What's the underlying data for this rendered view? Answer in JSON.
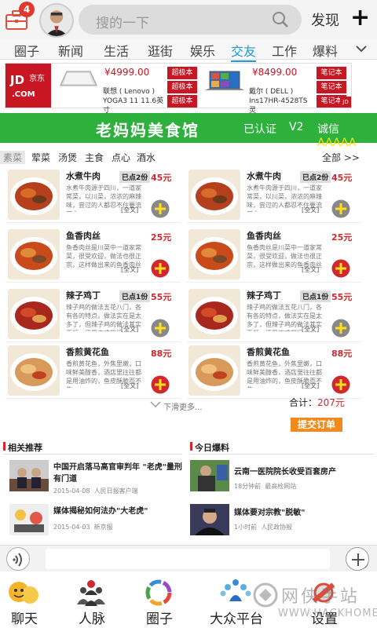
{
  "top_bar": {
    "notification_count": "4",
    "search_placeholder": "搜的一下",
    "discover_label": "发现",
    "plus_label": "+"
  },
  "tabs": [
    "圈子",
    "新闻",
    "生活",
    "逛街",
    "娱乐",
    "交友",
    "工作",
    "爆料"
  ],
  "active_tab": "交友",
  "ad": {
    "logo_text": "JD",
    "logo_cn": "京东",
    "logo_com": ".COM",
    "product1": {
      "price": "¥4999.00",
      "name1": "联想 ( Lenovo )",
      "name2": "YOGA3 11 11.6英寸",
      "btn1": "超极本",
      "btn2": "超极本",
      "btn3": "超极本"
    },
    "product2": {
      "price": "¥8499.00",
      "name1": "戴尔 ( DELL )",
      "name2": "Ins17HR-4528TS 灵",
      "btn1": "笔记本",
      "btn2": "笔记本",
      "btn3": "笔记本"
    },
    "corner": "JD"
  },
  "shop": {
    "name": "老妈妈美食馆",
    "certified": "已认证",
    "level": "V2",
    "trust_label": "诚信",
    "trust_rating": "AAAAA"
  },
  "menu_categories": [
    "素菜",
    "荤菜",
    "汤煲",
    "主食",
    "点心",
    "酒水"
  ],
  "menu_all": "全部 >>",
  "dishes": [
    {
      "name": "水煮牛肉",
      "tag": "已点2份",
      "price": "45元",
      "desc": "水煮牛肉源于四川，一道家常菜，以川菜，浓浓的麻辣味，尝过的人都忍不住要流口水",
      "full": "[全文]"
    },
    {
      "name": "水煮牛肉",
      "tag": "已点2份",
      "price": "45元",
      "desc": "水煮牛肉源于四川，一道家常菜，以川菜，浓浓的麻辣味，尝过的人都忍不住要流口水",
      "full": "[全文]"
    },
    {
      "name": "鱼香肉丝",
      "tag": "",
      "price": "25元",
      "desc": "鱼香肉丝是川菜中一道家常菜，很受欢迎，做法也很正宗，这样做出来的鱼香肉丝",
      "full": "[全文]"
    },
    {
      "name": "鱼香肉丝",
      "tag": "",
      "price": "25元",
      "desc": "鱼香肉丝是川菜中一道家常菜，很受欢迎，做法也很正宗，这样做出来的鱼香肉丝",
      "full": "[全文]"
    },
    {
      "name": "辣子鸡丁",
      "tag": "已点1份",
      "price": "55元",
      "desc": "辣子鸡的做法五花八门，各有各的特点，做法实在是太多了，但辣子鸡的做法其实要领，还是不难掌握",
      "full": "[全文]"
    },
    {
      "name": "辣子鸡丁",
      "tag": "已点1份",
      "price": "55元",
      "desc": "辣子鸡的做法五花八门，各有各的特点，做法实在是太多了，但辣子鸡的做法其实要领，还是不难掌握",
      "full": "[全文]"
    },
    {
      "name": "香煎黄花鱼",
      "tag": "",
      "price": "88元",
      "desc": "香煎黄花鱼，外焦里嫩，口味鲜美醇香，酒店里往往都是用油炸的，鱼皮酥脆而不焦",
      "full": "[全文]"
    },
    {
      "name": "香煎黄花鱼",
      "tag": "",
      "price": "88元",
      "desc": "香煎黄花鱼，外焦里嫩，口味鲜美醇香，酒店里往往都是用油炸的，鱼皮酥脆而不焦",
      "full": "[全文]"
    }
  ],
  "more_label": "下滑更多...",
  "total_label": "合计：",
  "total_value": "207元",
  "submit_label": "提交订单",
  "news": {
    "related_title": "相关推荐",
    "today_title": "今日爆料",
    "related": [
      {
        "title": "中国开启落马高官审判年 \"老虎\"量刑有门道",
        "date": "2015-04-08",
        "source": "人民日报客户端"
      },
      {
        "title": "媒体揭秘如何法办\"大老虎\"",
        "date": "2015-04-03",
        "source": "新京报"
      }
    ],
    "today": [
      {
        "title": "云南一医院院长收受百套房产",
        "time": "18分钟前",
        "source": "最高检网站"
      },
      {
        "title": "媒体要对宗教\"脱敏\"",
        "time": "1小时前",
        "source": "人民政协报"
      }
    ]
  },
  "bottom_nav": [
    "聊天",
    "人脉",
    "圈子",
    "大众平台",
    "设置"
  ],
  "watermark": {
    "text": "网侠手站",
    "url": "WWW.HACKHOME.COM"
  },
  "colors": {
    "accent_blue": "#1a9ad6",
    "shop_green": "#2db03c",
    "price_red": "#d0282e",
    "submit_orange": "#f08a1c",
    "jd_red": "#c81623"
  }
}
